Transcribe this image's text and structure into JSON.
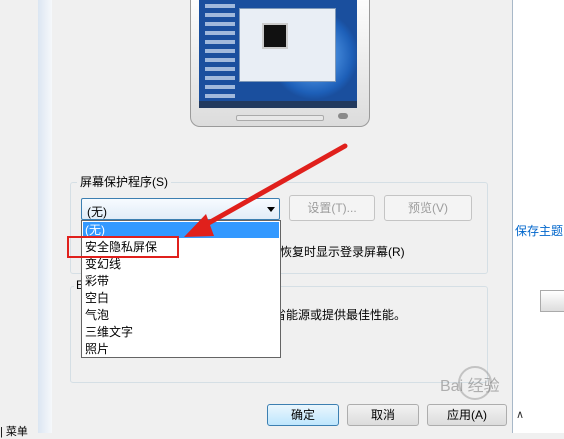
{
  "screensaver": {
    "group_label": "屏幕保护程序(S)",
    "selected": "(无)",
    "settings_label": "设置(T)...",
    "preview_label": "预览(V)",
    "resume_text": "恢复时显示登录屏幕(R)",
    "options": [
      "(无)",
      "安全隐私屏保",
      "变幻线",
      "彩带",
      "空白",
      "气泡",
      "三维文字",
      "照片"
    ],
    "highlighted_index": 0,
    "annotated_index": 1
  },
  "power": {
    "group_letter": "E",
    "text": "省能源或提供最佳性能。"
  },
  "dialog_buttons": {
    "ok": "确定",
    "cancel": "取消",
    "apply": "应用(A)"
  },
  "background": {
    "theme_link": "保存主题",
    "start_menu": "| 菜单",
    "chevron": "∧"
  },
  "watermark": {
    "text": "Bai 经验"
  },
  "colors": {
    "accent": "#3399ff",
    "annotation_red": "#e0201c",
    "link": "#0066cc"
  }
}
